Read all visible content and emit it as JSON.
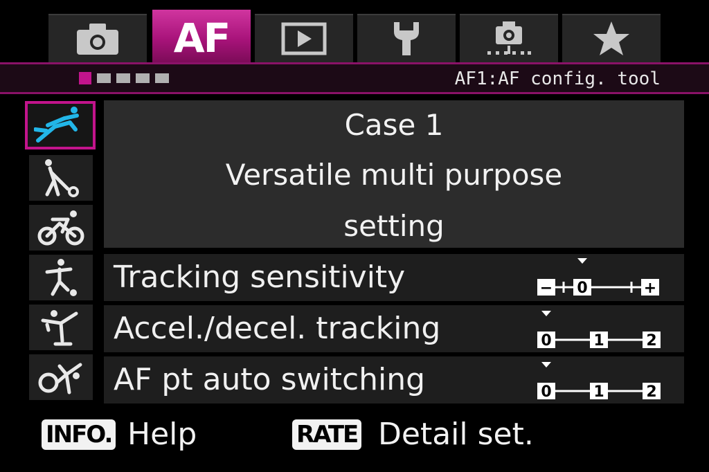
{
  "tabs": [
    {
      "name": "shooting",
      "icon": "camera-icon"
    },
    {
      "name": "af",
      "label": "AF",
      "active": true
    },
    {
      "name": "playback",
      "icon": "playback-icon"
    },
    {
      "name": "setup",
      "icon": "wrench-icon"
    },
    {
      "name": "live-view",
      "icon": "live-view-icon"
    },
    {
      "name": "my-menu",
      "icon": "star-icon"
    }
  ],
  "header": {
    "pages": 5,
    "active_page": 1,
    "title": "AF1:AF config. tool"
  },
  "cases": [
    {
      "icon": "case-1-runner-icon",
      "selected": true
    },
    {
      "icon": "case-2-tennis-icon"
    },
    {
      "icon": "case-3-cyclist-icon"
    },
    {
      "icon": "case-4-soccer-icon"
    },
    {
      "icon": "case-5-skater-icon"
    },
    {
      "icon": "case-6-gymnast-icon"
    }
  ],
  "case_panel": {
    "title": "Case 1",
    "desc_line1": "Versatile multi purpose",
    "desc_line2": "setting"
  },
  "settings": [
    {
      "label": "Tracking sensitivity",
      "scale": [
        "−",
        "0",
        "+"
      ],
      "value": "0"
    },
    {
      "label": "Accel./decel. tracking",
      "scale": [
        "0",
        "1",
        "2"
      ],
      "value": "0"
    },
    {
      "label": "AF pt auto switching",
      "scale": [
        "0",
        "1",
        "2"
      ],
      "value": "0"
    }
  ],
  "footer": {
    "info_key": "INFO.",
    "info_text": "Help",
    "rate_key": "RATE",
    "rate_text": "Detail set."
  },
  "colors": {
    "accent": "#c2148c",
    "selected_icon": "#22b6e8",
    "panel": "#2c2c2c"
  }
}
